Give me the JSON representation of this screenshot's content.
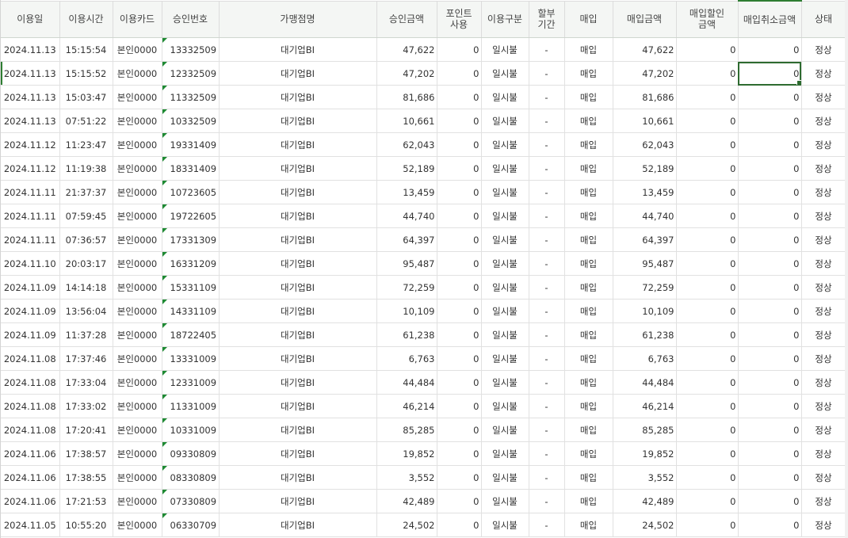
{
  "columns": [
    "이용일",
    "이용시간",
    "이용카드",
    "승인번호",
    "가맹점명",
    "승인금액",
    "포인트\n사용",
    "이용구분",
    "할부\n기간",
    "매입",
    "매입금액",
    "매입할인\n금액",
    "매입취소금액",
    "상태"
  ],
  "rows": [
    [
      "2024.11.13",
      "15:15:54",
      "본인0000",
      "13332509",
      "대기업BI",
      "47,622",
      "0",
      "일시불",
      "-",
      "매입",
      "47,622",
      "0",
      "0",
      "정상"
    ],
    [
      "2024.11.13",
      "15:15:52",
      "본인0000",
      "12332509",
      "대기업BI",
      "47,202",
      "0",
      "일시불",
      "-",
      "매입",
      "47,202",
      "0",
      "0",
      "정상"
    ],
    [
      "2024.11.13",
      "15:03:47",
      "본인0000",
      "11332509",
      "대기업BI",
      "81,686",
      "0",
      "일시불",
      "-",
      "매입",
      "81,686",
      "0",
      "0",
      "정상"
    ],
    [
      "2024.11.13",
      "07:51:22",
      "본인0000",
      "10332509",
      "대기업BI",
      "10,661",
      "0",
      "일시불",
      "-",
      "매입",
      "10,661",
      "0",
      "0",
      "정상"
    ],
    [
      "2024.11.12",
      "11:23:47",
      "본인0000",
      "19331409",
      "대기업BI",
      "62,043",
      "0",
      "일시불",
      "-",
      "매입",
      "62,043",
      "0",
      "0",
      "정상"
    ],
    [
      "2024.11.12",
      "11:19:38",
      "본인0000",
      "18331409",
      "대기업BI",
      "52,189",
      "0",
      "일시불",
      "-",
      "매입",
      "52,189",
      "0",
      "0",
      "정상"
    ],
    [
      "2024.11.11",
      "21:37:37",
      "본인0000",
      "10723605",
      "대기업BI",
      "13,459",
      "0",
      "일시불",
      "-",
      "매입",
      "13,459",
      "0",
      "0",
      "정상"
    ],
    [
      "2024.11.11",
      "07:59:45",
      "본인0000",
      "19722605",
      "대기업BI",
      "44,740",
      "0",
      "일시불",
      "-",
      "매입",
      "44,740",
      "0",
      "0",
      "정상"
    ],
    [
      "2024.11.11",
      "07:36:57",
      "본인0000",
      "17331309",
      "대기업BI",
      "64,397",
      "0",
      "일시불",
      "-",
      "매입",
      "64,397",
      "0",
      "0",
      "정상"
    ],
    [
      "2024.11.10",
      "20:03:17",
      "본인0000",
      "16331209",
      "대기업BI",
      "95,487",
      "0",
      "일시불",
      "-",
      "매입",
      "95,487",
      "0",
      "0",
      "정상"
    ],
    [
      "2024.11.09",
      "14:14:18",
      "본인0000",
      "15331109",
      "대기업BI",
      "72,259",
      "0",
      "일시불",
      "-",
      "매입",
      "72,259",
      "0",
      "0",
      "정상"
    ],
    [
      "2024.11.09",
      "13:56:04",
      "본인0000",
      "14331109",
      "대기업BI",
      "10,109",
      "0",
      "일시불",
      "-",
      "매입",
      "10,109",
      "0",
      "0",
      "정상"
    ],
    [
      "2024.11.09",
      "11:37:28",
      "본인0000",
      "18722405",
      "대기업BI",
      "61,238",
      "0",
      "일시불",
      "-",
      "매입",
      "61,238",
      "0",
      "0",
      "정상"
    ],
    [
      "2024.11.08",
      "17:37:46",
      "본인0000",
      "13331009",
      "대기업BI",
      "6,763",
      "0",
      "일시불",
      "-",
      "매입",
      "6,763",
      "0",
      "0",
      "정상"
    ],
    [
      "2024.11.08",
      "17:33:04",
      "본인0000",
      "12331009",
      "대기업BI",
      "44,484",
      "0",
      "일시불",
      "-",
      "매입",
      "44,484",
      "0",
      "0",
      "정상"
    ],
    [
      "2024.11.08",
      "17:33:02",
      "본인0000",
      "11331009",
      "대기업BI",
      "46,214",
      "0",
      "일시불",
      "-",
      "매입",
      "46,214",
      "0",
      "0",
      "정상"
    ],
    [
      "2024.11.08",
      "17:20:41",
      "본인0000",
      "10331009",
      "대기업BI",
      "85,285",
      "0",
      "일시불",
      "-",
      "매입",
      "85,285",
      "0",
      "0",
      "정상"
    ],
    [
      "2024.11.06",
      "17:38:57",
      "본인0000",
      "09330809",
      "대기업BI",
      "19,852",
      "0",
      "일시불",
      "-",
      "매입",
      "19,852",
      "0",
      "0",
      "정상"
    ],
    [
      "2024.11.06",
      "17:38:55",
      "본인0000",
      "08330809",
      "대기업BI",
      "3,552",
      "0",
      "일시불",
      "-",
      "매입",
      "3,552",
      "0",
      "0",
      "정상"
    ],
    [
      "2024.11.06",
      "17:21:53",
      "본인0000",
      "07330809",
      "대기업BI",
      "42,489",
      "0",
      "일시불",
      "-",
      "매입",
      "42,489",
      "0",
      "0",
      "정상"
    ],
    [
      "2024.11.05",
      "10:55:20",
      "본인0000",
      "06330709",
      "대기업BI",
      "24,502",
      "0",
      "일시불",
      "-",
      "매입",
      "24,502",
      "0",
      "0",
      "정상"
    ]
  ],
  "selection": {
    "row": 2,
    "column": "매입취소금액"
  },
  "colors": {
    "accent": "#2e7d32",
    "header_bg": "#f4f6f4",
    "marker": "#1e8a33"
  }
}
